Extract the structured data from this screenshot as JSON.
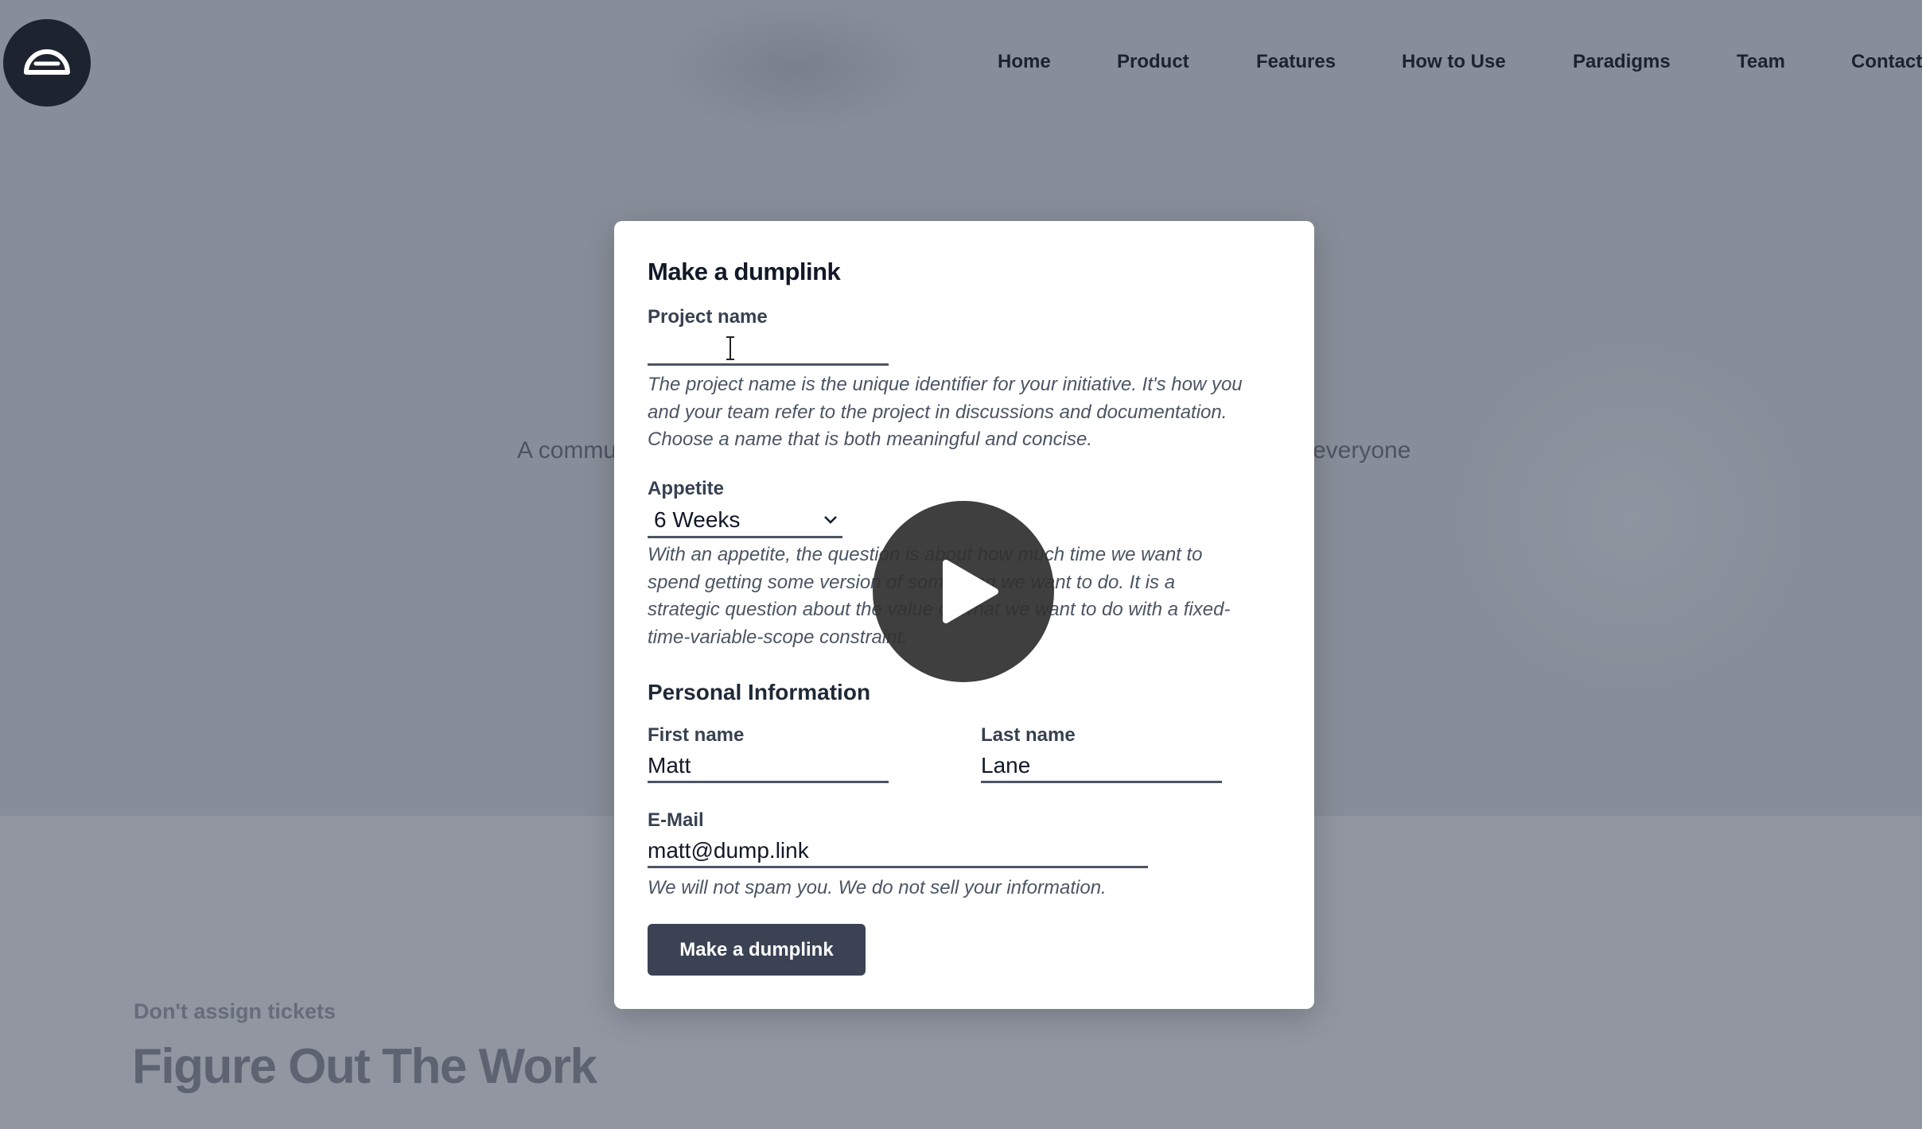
{
  "nav": {
    "items": [
      "Home",
      "Product",
      "Features",
      "How to Use",
      "Paradigms",
      "Team",
      "Contact"
    ]
  },
  "hero": {
    "subtitle_left": "A commu",
    "subtitle_right": "everyone"
  },
  "section": {
    "tagline": "Don't assign tickets",
    "headline": "Figure Out The Work"
  },
  "modal": {
    "title": "Make a dumplink",
    "project": {
      "label": "Project name",
      "value": "",
      "help": [
        "The project name is the unique identifier for your initiative. It's how you",
        "and your team refer to the project in discussions and documentation.",
        "Choose a name that is both meaningful and concise."
      ]
    },
    "appetite": {
      "label": "Appetite",
      "value": "6 Weeks",
      "help": [
        "With an appetite, the question is about how much time we want to",
        "spend getting some version of something we want to do. It is a",
        "strategic question about the value of what we want to do with a fixed-",
        "time-variable-scope constraint."
      ]
    },
    "personal_title": "Personal Information",
    "first_name": {
      "label": "First name",
      "value": "Matt"
    },
    "last_name": {
      "label": "Last name",
      "value": "Lane"
    },
    "email": {
      "label": "E-Mail",
      "value": "matt@dump.link",
      "help": "We will not spam you. We do not sell your information."
    },
    "submit_label": "Make a dumplink"
  },
  "icons": {
    "logo": "dome-logo-icon",
    "select": "chevron-down-icon",
    "cursor": "text-cursor-icon",
    "video": "play-icon"
  },
  "colors": {
    "backdrop": "#888e99",
    "button": "#3b4253",
    "logo_bg": "#1e2330"
  }
}
